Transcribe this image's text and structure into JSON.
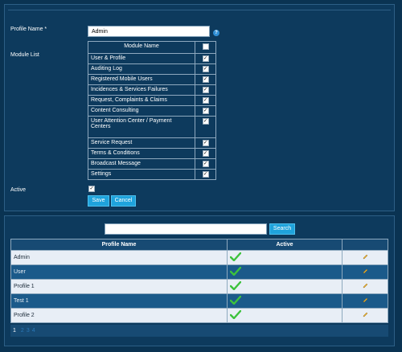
{
  "form": {
    "profile_name_label": "Profile Name *",
    "profile_name_value": "Admin",
    "module_list_label": "Module List",
    "module_name_header": "Module Name",
    "modules": [
      "User & Profile",
      "Auditing Log",
      "Registered Mobile Users",
      "Incidences & Services Failures",
      "Request, Complaints & Claims",
      "Content Consulting",
      "User Attention Center / Payment Centers",
      "Service Request",
      "Terms & Conditions",
      "Broadcast Message",
      "Settings"
    ],
    "active_label": "Active",
    "save_label": "Save",
    "cancel_label": "Cancel"
  },
  "search": {
    "value": "",
    "button_label": "Search"
  },
  "profiles_table": {
    "headers": [
      "Profile Name",
      "Active",
      ""
    ],
    "rows": [
      {
        "name": "Admin"
      },
      {
        "name": "User"
      },
      {
        "name": "Profile 1"
      },
      {
        "name": "Test 1"
      },
      {
        "name": "Profile 2"
      }
    ]
  },
  "pager": {
    "current": "1",
    "pages": [
      "2",
      "3",
      "4"
    ]
  },
  "colors": {
    "background": "#0a3352",
    "button": "#1fa3dc",
    "check": "#3cc23c"
  },
  "icons": {
    "help": "question-mark-circle",
    "active": "green-checkmark",
    "edit": "pencil"
  }
}
